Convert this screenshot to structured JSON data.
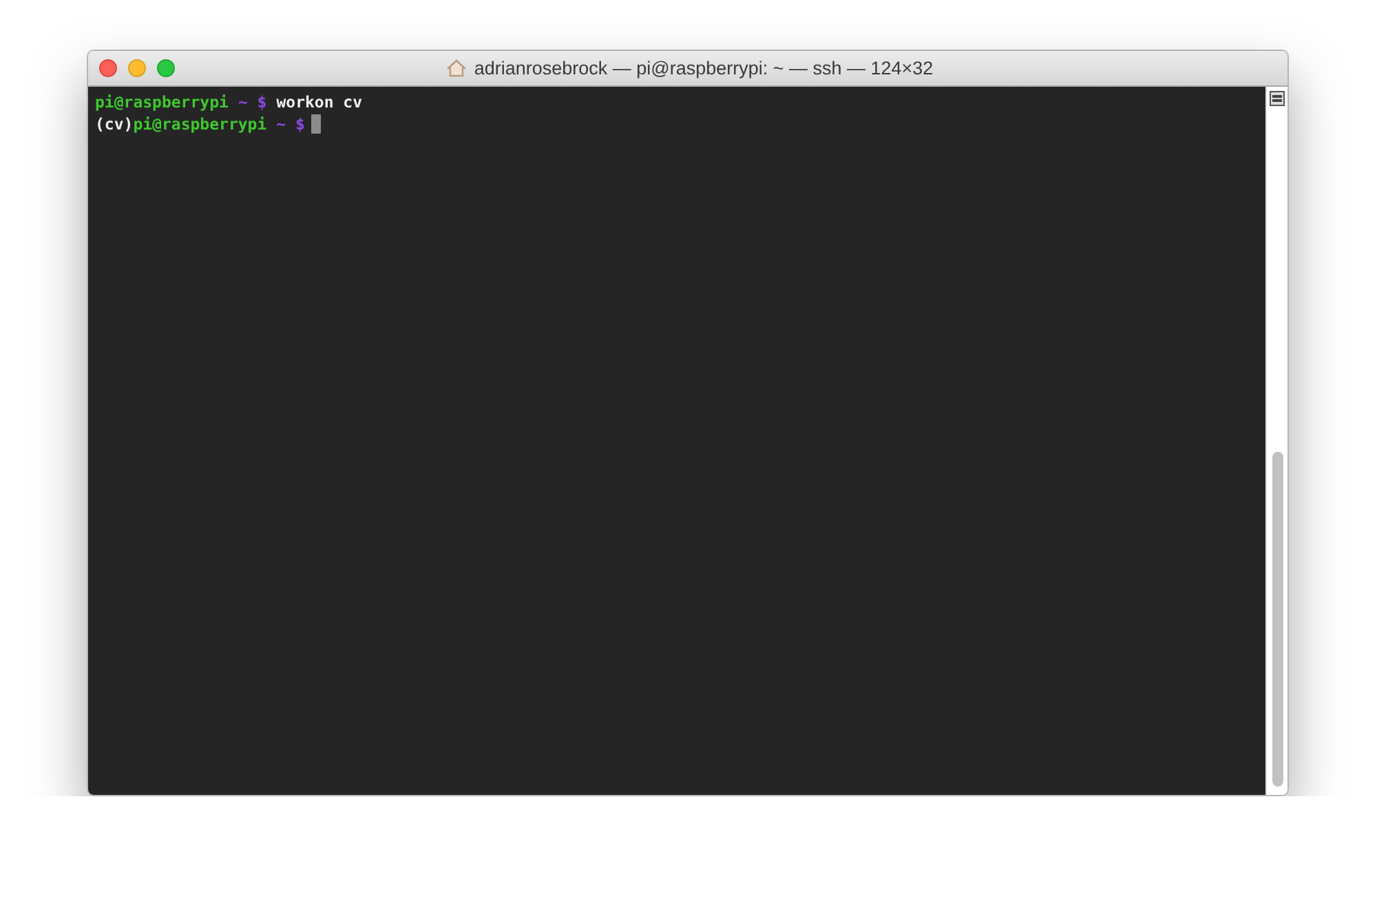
{
  "window": {
    "title": "adrianrosebrock — pi@raspberrypi: ~ — ssh — 124×32"
  },
  "terminal": {
    "lines": [
      {
        "segments": [
          {
            "kind": "user",
            "text": "pi@raspberrypi"
          },
          {
            "kind": "path",
            "text": "~ $"
          },
          {
            "kind": "command",
            "text": "workon cv"
          }
        ],
        "cursor": false
      },
      {
        "segments": [
          {
            "kind": "plain",
            "text": "(cv)"
          },
          {
            "kind": "user",
            "text": "pi@raspberrypi"
          },
          {
            "kind": "path",
            "text": "~ $"
          }
        ],
        "cursor": true
      }
    ]
  }
}
